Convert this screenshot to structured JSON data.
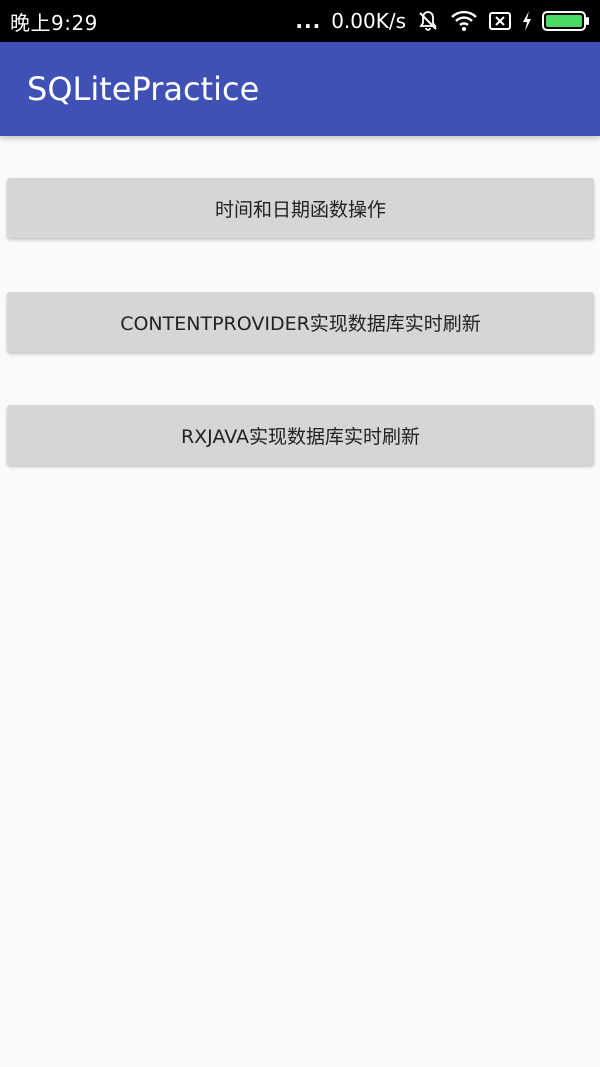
{
  "status_bar": {
    "time": "晚上9:29",
    "dots": "...",
    "net_speed": "0.00K/s"
  },
  "app_bar": {
    "title": "SQLitePractice"
  },
  "buttons": [
    {
      "label": "时间和日期函数操作"
    },
    {
      "label": "CONTENTPROVIDER实现数据库实时刷新"
    },
    {
      "label": "RXJAVA实现数据库实时刷新"
    }
  ],
  "colors": {
    "app_bar": "#3f51b5",
    "status_bar": "#000000",
    "button_bg": "#d6d6d6",
    "background": "#fafafa",
    "battery_fill": "#4cd964"
  },
  "icons": [
    "mute-icon",
    "wifi-icon",
    "sim-x-icon",
    "charging-icon",
    "battery-icon"
  ]
}
